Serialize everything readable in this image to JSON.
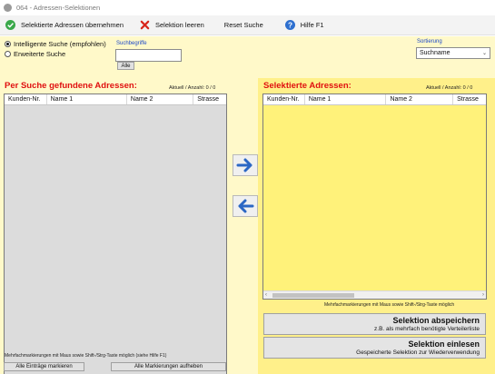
{
  "window": {
    "title": "064 - Adressen-Selektionen"
  },
  "toolbar": {
    "accept_label": "Selektierte Adressen übernehmen",
    "clear_label": "Selektion leeren",
    "reset_label": "Reset Suche",
    "help_label": "Hilfe F1"
  },
  "search": {
    "mode_smart": "Intelligente Suche (empfohlen)",
    "mode_extended": "Erweiterte Suche",
    "terms_label": "Suchbegriffe",
    "terms_value": "",
    "all_button": "Alle"
  },
  "sort": {
    "label": "Sortierung",
    "value": "Suchname"
  },
  "left": {
    "title": "Per Suche gefundene Adressen:",
    "count": "Aktuell / Anzahl:   0 / 0",
    "columns": [
      "Kunden-Nr.",
      "Name 1",
      "Name 2",
      "Strasse"
    ],
    "hint": "Mehrfachmarkierungen mit Maus sowie Shift-/Strg-Taste möglich (siehe Hilfe F1)",
    "mark_all": "Alle Einträge markieren",
    "unmark_all": "Alle Markierungen aufheben"
  },
  "right": {
    "title": "Selektierte Adressen:",
    "count": "Aktuell / Anzahl:   0 / 0",
    "columns": [
      "Kunden-Nr.",
      "Name 1",
      "Name 2",
      "Strasse"
    ],
    "hint": "Mehrfachmarkierungen mit Maus sowie Shift-/Strg-Taste möglich",
    "save_title": "Selektion abspeichern",
    "save_sub": "z.B. als mehrfach benötigte Verteilerliste",
    "load_title": "Selektion einlesen",
    "load_sub": "Gespeicherte Selektion zur Wiederverwendung"
  },
  "colors": {
    "background": "#fff9c9",
    "panel": "#fff08a",
    "title_red": "#e01010",
    "arrow_blue": "#2b67c4"
  }
}
